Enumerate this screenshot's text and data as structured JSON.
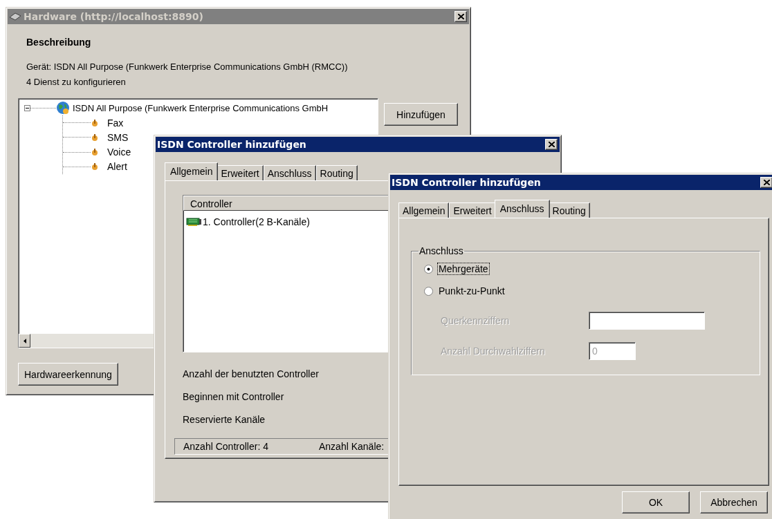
{
  "hardware_window": {
    "title": "Hardware (http://localhost:8890)",
    "active": false,
    "heading": "Beschreibung",
    "device_line": "Gerät: ISDN All Purpose (Funkwerk Enterprise Communications GmbH (RMCC))",
    "services_line": "4 Dienst zu konfigurieren",
    "tree": {
      "label": "ISDN All Purpose (Funkwerk Enterprise Communications GmbH",
      "expanded": true,
      "children": [
        {
          "label": "Fax"
        },
        {
          "label": "SMS"
        },
        {
          "label": "Voice"
        },
        {
          "label": "Alert"
        }
      ]
    },
    "add_button": "Hinzufügen",
    "detect_button": "Hardwareerkennung"
  },
  "controller_dialog": {
    "title": "ISDN Controller hinzufügen",
    "active": true,
    "tabs": [
      {
        "label": "Allgemein",
        "selected": true
      },
      {
        "label": "Erweitert",
        "selected": false
      },
      {
        "label": "Anschluss",
        "selected": false
      },
      {
        "label": "Routing",
        "selected": false
      }
    ],
    "list": {
      "column": "Controller",
      "items": [
        "1. Controller(2 B-Kanäle)"
      ]
    },
    "labels": [
      "Anzahl der benutzten Controller",
      "Beginnen mit Controller",
      "Reservierte Kanäle"
    ],
    "status": [
      "Anzahl Controller: 4",
      "Anzahl Kanäle:"
    ]
  },
  "connection_dialog": {
    "title": "ISDN Controller hinzufügen",
    "active": true,
    "tabs": [
      {
        "label": "Allgemein",
        "selected": false
      },
      {
        "label": "Erweitert",
        "selected": false
      },
      {
        "label": "Anschluss",
        "selected": true
      },
      {
        "label": "Routing",
        "selected": false
      }
    ],
    "group": {
      "legend": "Anschluss",
      "options": [
        {
          "label": "Mehrgeräte",
          "selected": true,
          "focused": true
        },
        {
          "label": "Punkt-zu-Punkt",
          "selected": false,
          "focused": false
        }
      ],
      "fields": [
        {
          "label": "Querkennziffern",
          "disabled": true
        },
        {
          "label": "Anzahl Durchwahlziffern",
          "value": "0",
          "disabled": true
        }
      ]
    },
    "buttons": [
      "OK",
      "Abbrechen"
    ]
  }
}
